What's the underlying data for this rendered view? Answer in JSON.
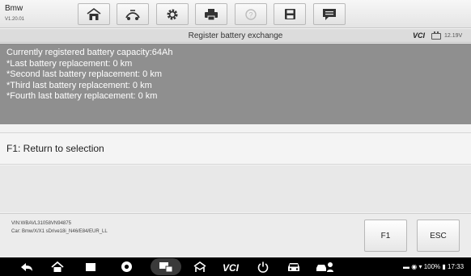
{
  "app": {
    "name": "Bmw",
    "version": "V1.20.01"
  },
  "toolbar": {
    "buttons": [
      {
        "icon": "home-icon"
      },
      {
        "icon": "car-link-icon"
      },
      {
        "icon": "settings-gear-icon"
      },
      {
        "icon": "printer-icon"
      },
      {
        "icon": "help-icon"
      },
      {
        "icon": "save-icon"
      },
      {
        "icon": "data-logging-icon"
      }
    ]
  },
  "titlebar": {
    "title": "Register battery exchange",
    "vci": "VCI",
    "voltage": "12.19V"
  },
  "info": {
    "lines": [
      "Currently registered battery capacity:64Ah",
      "*Last battery replacement: 0 km",
      "*Second last battery replacement: 0 km",
      "*Third last battery replacement: 0 km",
      "*Fourth last battery replacement: 0 km"
    ]
  },
  "selection": {
    "label": "F1: Return to selection"
  },
  "vehicle": {
    "vin": "VIN:WBAVL31058VN94875",
    "car": "Car: Bmw/X/X1 sDrive18i_N46/E84/EUR_LL"
  },
  "buttons": {
    "f1": "F1",
    "esc": "ESC"
  },
  "navbar": {
    "icons": [
      "back-icon",
      "home-icon",
      "recent-apps-icon",
      "browser-icon",
      "remote-desk-icon",
      "maxifix-icon",
      "vci-manager-icon",
      "power-icon",
      "car-icon",
      "service-car-icon"
    ],
    "status": {
      "battery": "100%",
      "time": "17:33"
    }
  },
  "colors": {
    "info_bg": "#8f8f8f",
    "navbar_bg": "#000000",
    "toolbar_bg": "#e4e4e4"
  }
}
